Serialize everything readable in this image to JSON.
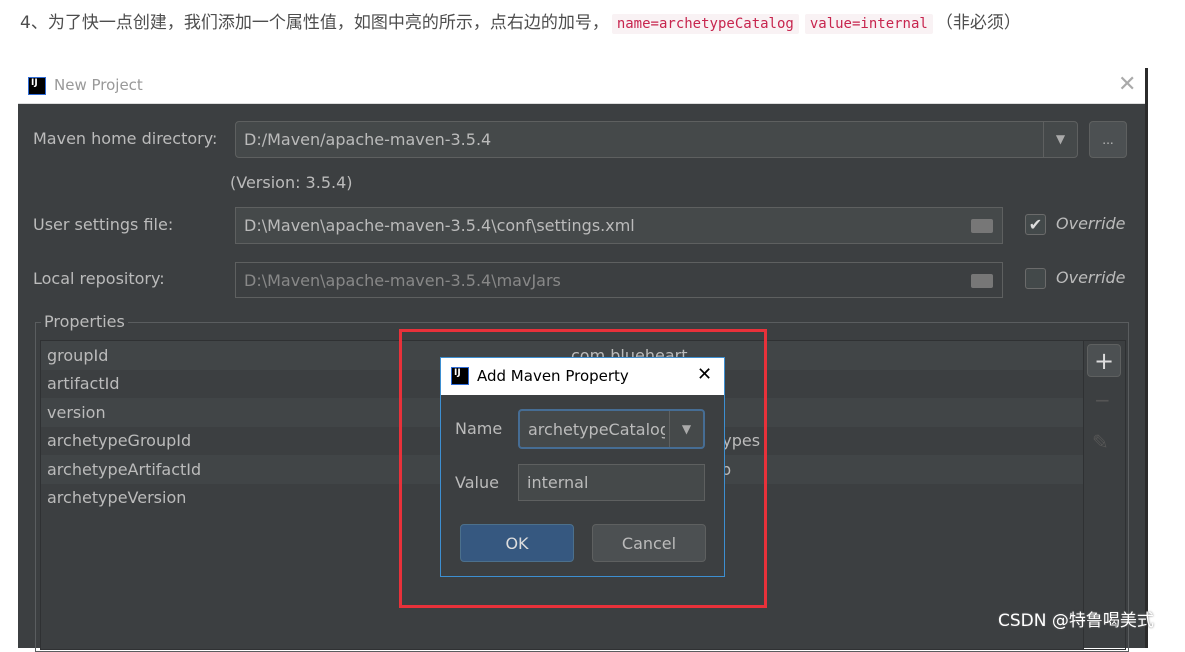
{
  "intro": {
    "text": "4、为了快一点创建，我们添加一个属性值，如图中亮的所示，点右边的加号，",
    "code1": "name=archetypeCatalog",
    "code2": "value=internal",
    "tail": "（非必须）"
  },
  "window": {
    "title": "New Project",
    "close": "✕"
  },
  "form": {
    "maven_home_label": "Maven home directory:",
    "maven_home_value": "D:/Maven/apache-maven-3.5.4",
    "browse": "...",
    "version": "(Version: 3.5.4)",
    "settings_label": "User settings file:",
    "settings_value": "D:\\Maven\\apache-maven-3.5.4\\conf\\settings.xml",
    "settings_override": "Override",
    "settings_override_checked": true,
    "repo_label": "Local repository:",
    "repo_value": "D:\\Maven\\apache-maven-3.5.4\\mavJars",
    "repo_override": "Override",
    "repo_override_checked": false
  },
  "properties": {
    "title": "Properties",
    "rows": [
      {
        "name": "groupId",
        "value": "com.blueheart"
      },
      {
        "name": "artifactId",
        "value": ""
      },
      {
        "name": "version",
        "value": ""
      },
      {
        "name": "archetypeGroupId",
        "value": "rchetypes"
      },
      {
        "name": "archetypeArtifactId",
        "value": "ebapp"
      },
      {
        "name": "archetypeVersion",
        "value": ""
      }
    ],
    "add": "+",
    "remove": "−",
    "edit": "✎"
  },
  "dialog": {
    "title": "Add Maven Property",
    "close": "✕",
    "name_label": "Name",
    "name_value": "archetypeCatalog",
    "value_label": "Value",
    "value_value": "internal",
    "ok": "OK",
    "cancel": "Cancel"
  },
  "highlight_color": "#e8313a",
  "watermark": "CSDN @特鲁喝美式"
}
